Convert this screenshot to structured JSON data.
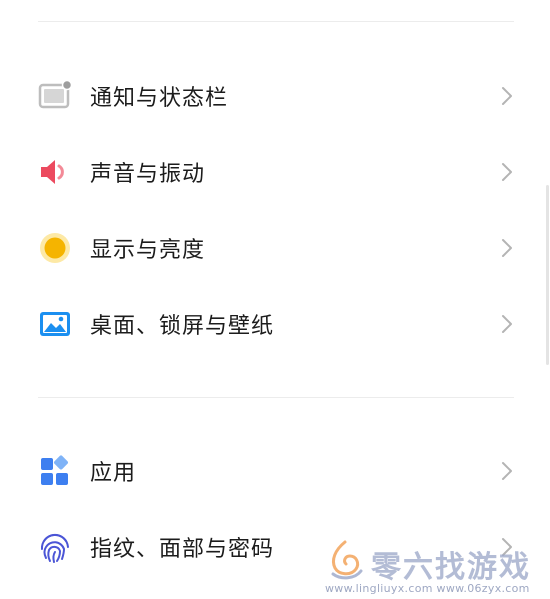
{
  "settings": {
    "group1": [
      {
        "label": "通知与状态栏",
        "icon": "notification-icon"
      },
      {
        "label": "声音与振动",
        "icon": "speaker-icon"
      },
      {
        "label": "显示与亮度",
        "icon": "brightness-icon"
      },
      {
        "label": "桌面、锁屏与壁纸",
        "icon": "wallpaper-icon"
      }
    ],
    "group2": [
      {
        "label": "应用",
        "icon": "apps-icon"
      },
      {
        "label": "指纹、面部与密码",
        "icon": "fingerprint-icon"
      }
    ]
  },
  "watermark": {
    "title": "零六找游戏",
    "url": "www.lingliuyx.com    www.06zyx.com"
  },
  "colors": {
    "speaker": "#ec4a5f",
    "brightness": "#f4b400",
    "wallpaper": "#1b8ff0",
    "apps": "#3d7ff0",
    "fingerprint": "#4b55d6",
    "notification": "#b9b9b9"
  }
}
